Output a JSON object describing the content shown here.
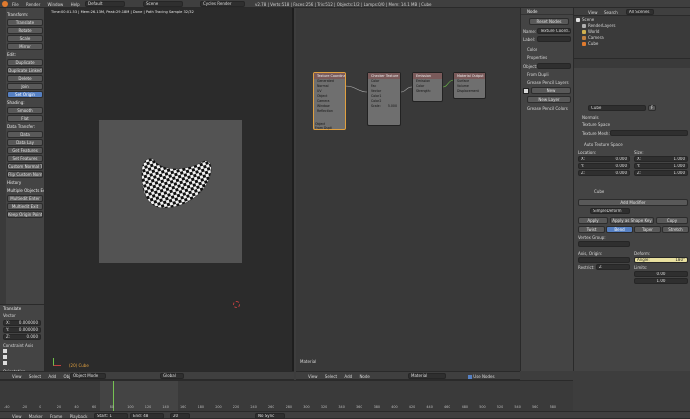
{
  "top_bar": {
    "menus": [
      "File",
      "Render",
      "Window",
      "Help"
    ],
    "layout": "Default",
    "scene": "Scene",
    "engine": "Cycles Render",
    "version_info": "v2.78 | Verts:518 | Faces:256 | Tris:512 | Objects:1/2 | Lamps:0/0 | Mem: 14.1 MB | Cube"
  },
  "tool_shelf": {
    "sections": [
      {
        "title": "Transform:",
        "buttons": [
          "Translate",
          "Rotate",
          "Scale",
          "Mirror"
        ]
      },
      {
        "title": "Edit:",
        "buttons": [
          "Duplicate",
          "Duplicate Linked",
          "Delete",
          "Join",
          "Set Origin"
        ]
      },
      {
        "title": "Shading:",
        "buttons": [
          "Smooth",
          "Flat"
        ]
      },
      {
        "title": "Data Transfer:",
        "buttons": [
          "Data",
          "Data Lay"
        ]
      },
      {
        "title": "",
        "buttons": [
          "Get Features",
          "Set Features",
          "Custom Normal Tools",
          "Flip Custom Normals"
        ]
      },
      {
        "title": "History",
        "buttons": []
      },
      {
        "title": "Multiple Objects Editor",
        "buttons": [
          "Multiedit Enter",
          "Multiedit Exit",
          "Keep Origin Point"
        ]
      }
    ],
    "translate_panel": {
      "title": "Translate",
      "vector_label": "Vector",
      "x": "X:",
      "x_val": "0.000000",
      "y": "Y:",
      "y_val": "0.000000",
      "z": "Z:",
      "z_val": "0.000",
      "constraint": "Constraint Axis",
      "orientation": "Orientation"
    }
  },
  "viewport": {
    "status": "Time:00:01.53 | Mem:26.13M, Peak:29.18M | Done | Path Tracing Sample 32/32",
    "object_label": "(20) Cube",
    "footer": [
      "View",
      "Select",
      "Add",
      "Object"
    ],
    "mode": "Object Mode",
    "shading": "Global"
  },
  "node_editor": {
    "nodes": [
      {
        "title": "Texture Coordinate",
        "rows": [
          "Generated",
          "Normal",
          "UV",
          "Object",
          "Camera",
          "Window",
          "Reflection"
        ]
      },
      {
        "title": "Checker Texture",
        "rows": [
          "Color",
          "Fac",
          "Vector",
          "Color1",
          "Color2",
          "Scale:"
        ],
        "scale_val": "5.000"
      },
      {
        "title": "Emission",
        "rows": [
          "Emission",
          "Color",
          "Strength:"
        ],
        "strength_val": "1.000"
      },
      {
        "title": "Material Output",
        "rows": [
          "Surface",
          "Volume",
          "Displacement"
        ]
      }
    ],
    "from_dupli": "From Dupli",
    "object_label": "Object",
    "label": "Material",
    "footer": [
      "View",
      "Select",
      "Add",
      "Node"
    ],
    "material_name": "Material",
    "use_nodes": "Use Nodes"
  },
  "node_sidebar": {
    "reset_button": "Reset Nodes",
    "name_label": "Name:",
    "name_val": "Texture Coord...",
    "label_label": "Label:",
    "color_title": "Color",
    "properties_title": "Properties",
    "object_field": "Object:",
    "from_dupli": "From Dupli",
    "grease_pencil_title": "Grease Pencil Layers",
    "gp_new": "New",
    "gp_new_layer": "New Layer",
    "gp_colors": "Grease Pencil Colors"
  },
  "outliner": {
    "menus": [
      "View",
      "Search",
      "All Scenes"
    ],
    "items": [
      "Scene",
      "RenderLayers",
      "World",
      "Camera",
      "Cube"
    ]
  },
  "properties": {
    "mesh_name": "Cube",
    "fake_user": "F",
    "normals": "Normals",
    "texture_space": "Texture Space",
    "texture_mesh": "Texture Mesh:",
    "auto_texture": "Auto Texture Space",
    "location": "Location:",
    "size": "Size:",
    "loc": [
      {
        "axis": "X:",
        "val": "0.000"
      },
      {
        "axis": "Y:",
        "val": "0.000"
      },
      {
        "axis": "Z:",
        "val": "0.000"
      }
    ],
    "size_vals": [
      {
        "axis": "X:",
        "val": "1.000"
      },
      {
        "axis": "Y:",
        "val": "1.000"
      },
      {
        "axis": "Z:",
        "val": "1.000"
      }
    ],
    "cube_label": "Cube",
    "add_modifier": "Add Modifier",
    "modifier_name": "SimpleDeform",
    "apply": "Apply",
    "apply_shape": "Apply as Shape Key",
    "copy": "Copy",
    "modes": [
      "Twist",
      "Bend",
      "Taper",
      "Stretch"
    ],
    "active_mode": "Bend",
    "vertex_group": "Vertex Group:",
    "axis_origin": "Axis, Origin:",
    "deform": "Deform:",
    "angle_label": "Angle:",
    "angle_val": "180°",
    "restrict": "Restrict:",
    "axis_z": "Z",
    "limits": "Limits:",
    "limit_a": "0.00",
    "limit_b": "1.00"
  },
  "timeline": {
    "footer": [
      "View",
      "Marker",
      "Frame",
      "Playback"
    ],
    "start_label": "Start:",
    "start_val": "1",
    "end_label": "End:",
    "end_val": "48",
    "frame_val": "20",
    "sync": "No Sync",
    "ticks": [
      "-40",
      "-20",
      "0",
      "20",
      "40",
      "60",
      "80",
      "100",
      "120",
      "140",
      "160",
      "180",
      "200",
      "220",
      "240",
      "260",
      "280",
      "300",
      "320",
      "340",
      "360",
      "380",
      "400",
      "420",
      "440",
      "460",
      "480",
      "500",
      "520",
      "540",
      "560",
      "580"
    ]
  },
  "colors": {
    "accent": "#5680c2",
    "node_bg": "#6f6f6f",
    "node_active": "#e0a040",
    "viewport_bg": "#2b2b2b",
    "canvas_gray": "#535353"
  }
}
